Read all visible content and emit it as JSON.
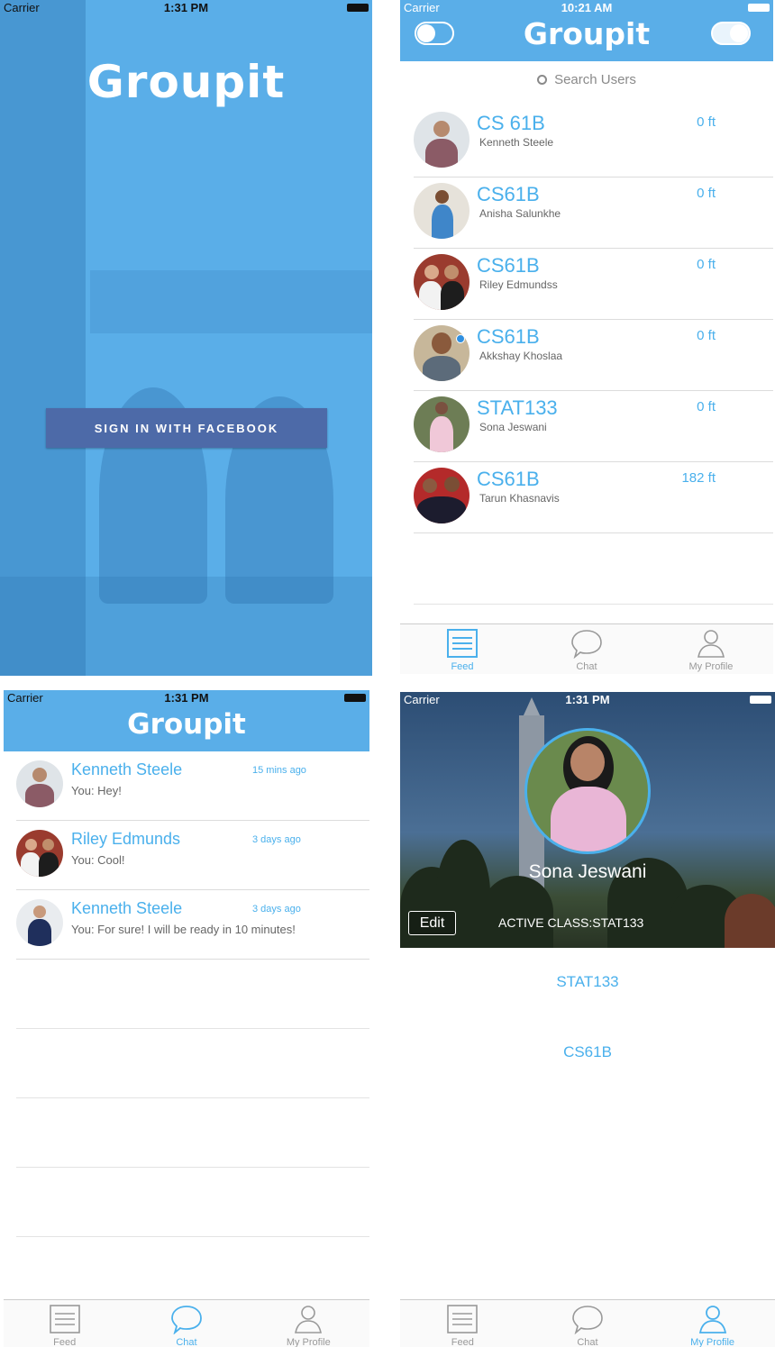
{
  "login_screen": {
    "status": {
      "carrier": "Carrier",
      "time": "1:31 PM"
    },
    "logo": "Groupit",
    "facebook_button": "SIGN IN WITH FACEBOOK"
  },
  "feed_screen": {
    "status": {
      "carrier": "Carrier",
      "time": "10:21 AM"
    },
    "title": "Groupit",
    "search_placeholder": "Search Users",
    "items": [
      {
        "course": "CS 61B",
        "person": "Kenneth Steele",
        "distance": "0 ft"
      },
      {
        "course": "CS61B",
        "person": "Anisha Salunkhe",
        "distance": "0 ft"
      },
      {
        "course": "CS61B",
        "person": "Riley Edmundss",
        "distance": "0 ft"
      },
      {
        "course": "CS61B",
        "person": "Akkshay Khoslaa",
        "distance": "0 ft"
      },
      {
        "course": "STAT133",
        "person": "Sona Jeswani",
        "distance": "0 ft"
      },
      {
        "course": "CS61B",
        "person": "Tarun Khasnavis",
        "distance": "182 ft"
      }
    ],
    "tabs": {
      "feed": "Feed",
      "chat": "Chat",
      "profile": "My Profile"
    }
  },
  "chat_screen": {
    "status": {
      "carrier": "Carrier",
      "time": "1:31 PM"
    },
    "title": "Groupit",
    "conversations": [
      {
        "name": "Kenneth Steele",
        "ago": "15 mins ago",
        "message": "You: Hey!"
      },
      {
        "name": "Riley Edmunds",
        "ago": "3 days ago",
        "message": "You: Cool!"
      },
      {
        "name": "Kenneth Steele",
        "ago": "3 days ago",
        "message": "You: For sure! I will be ready in 10 minutes!"
      }
    ],
    "tabs": {
      "feed": "Feed",
      "chat": "Chat",
      "profile": "My Profile"
    }
  },
  "profile_screen": {
    "status": {
      "carrier": "Carrier",
      "time": "1:31 PM"
    },
    "name": "Sona Jeswani",
    "edit_label": "Edit",
    "active_class": "ACTIVE CLASS:STAT133",
    "courses": [
      "STAT133",
      "CS61B"
    ],
    "tabs": {
      "feed": "Feed",
      "chat": "Chat",
      "profile": "My Profile"
    }
  },
  "colors": {
    "brand_blue": "#5aaee8",
    "accent_text": "#4ab0ec",
    "facebook": "#4d6aa8"
  }
}
